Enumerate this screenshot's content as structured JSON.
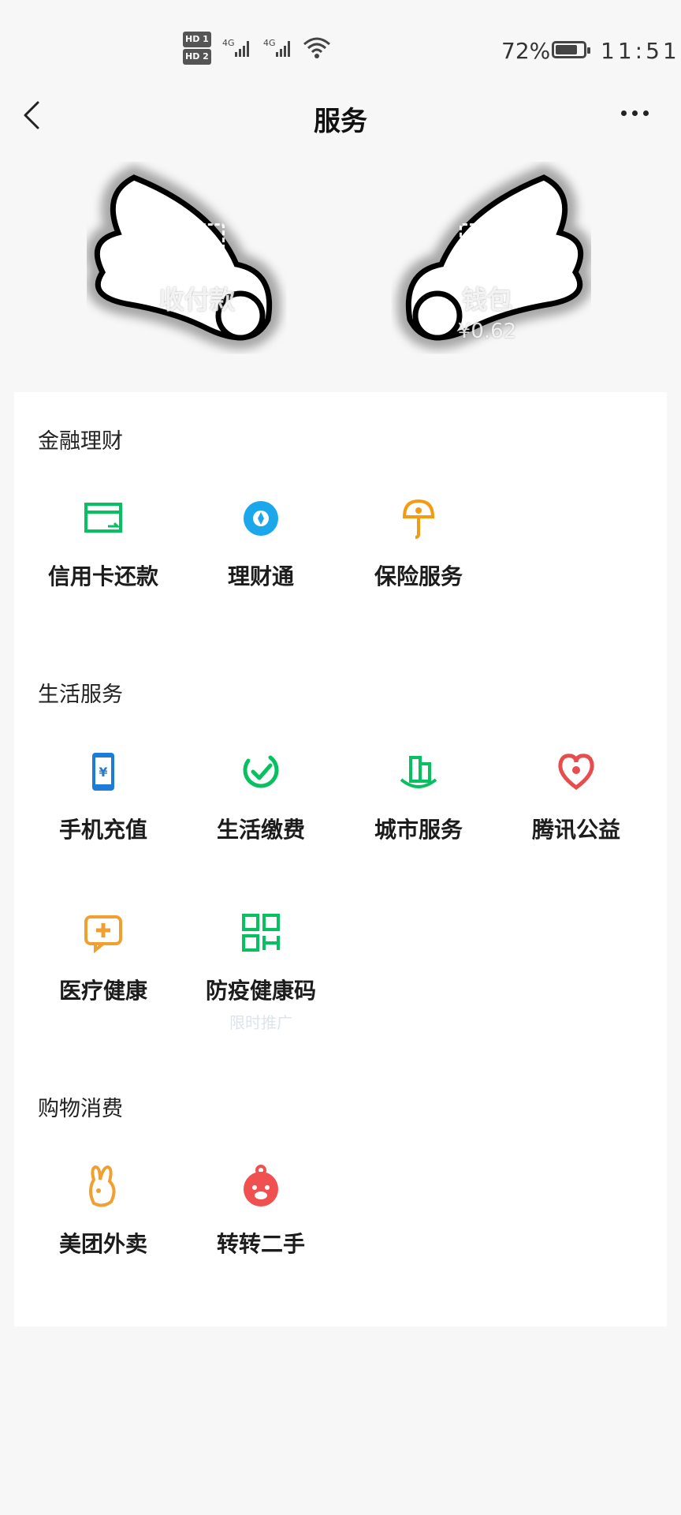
{
  "status_bar": {
    "sim1": "HD 1",
    "sim2": "HD 2",
    "net1": "4G",
    "net2": "4G",
    "battery_percent": "72%",
    "time": "11:51"
  },
  "header": {
    "title": "服务"
  },
  "hero": {
    "pay_label": "收付款",
    "wallet_label": "钱包",
    "wallet_balance": "¥0.62"
  },
  "sections": [
    {
      "title": "金融理财",
      "items": [
        {
          "label": "信用卡还款",
          "icon": "credit-card-icon",
          "color": "#07c160"
        },
        {
          "label": "理财通",
          "icon": "wealth-icon",
          "color": "#1aa7ec"
        },
        {
          "label": "保险服务",
          "icon": "insurance-icon",
          "color": "#f39c12"
        }
      ]
    },
    {
      "title": "生活服务",
      "items": [
        {
          "label": "手机充值",
          "icon": "phone-recharge-icon",
          "color": "#1f7bd8"
        },
        {
          "label": "生活缴费",
          "icon": "utility-payment-icon",
          "color": "#07c160"
        },
        {
          "label": "城市服务",
          "icon": "city-services-icon",
          "color": "#07c160"
        },
        {
          "label": "腾讯公益",
          "icon": "charity-heart-icon",
          "color": "#e84c4c"
        },
        {
          "label": "医疗健康",
          "icon": "medical-icon",
          "color": "#f0a030"
        },
        {
          "label": "防疫健康码",
          "icon": "qr-code-icon",
          "color": "#07c160",
          "sub": "限时推广"
        }
      ]
    },
    {
      "title": "购物消费",
      "items": [
        {
          "label": "美团外卖",
          "icon": "meituan-rabbit-icon",
          "color": "#f0a030"
        },
        {
          "label": "转转二手",
          "icon": "zhuanzhuan-icon",
          "color": "#f05050"
        }
      ]
    }
  ]
}
